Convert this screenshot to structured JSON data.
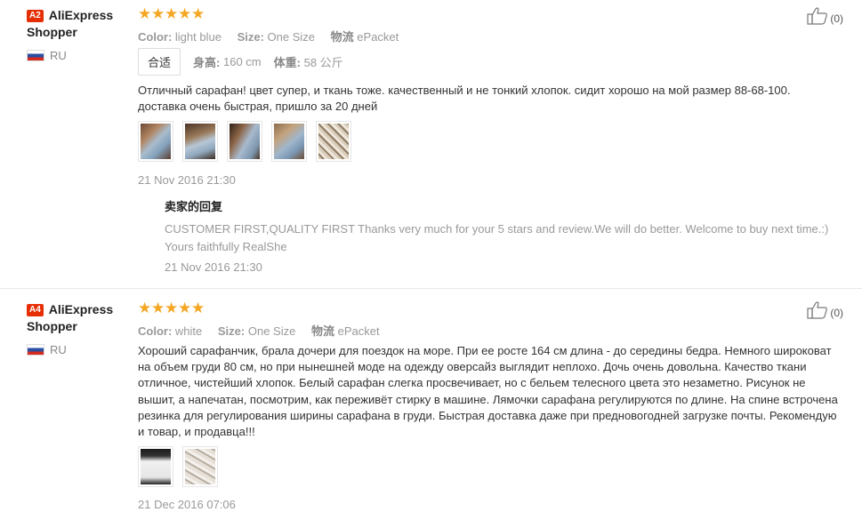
{
  "reviews": [
    {
      "level_badge": "A2",
      "user_name": "AliExpress Shopper",
      "country": "RU",
      "rating": 5,
      "color_label": "Color:",
      "color_value": "light blue",
      "size_label": "Size:",
      "size_value": "One Size",
      "shipping_label": "物流",
      "shipping_value": "ePacket",
      "fit_label": "合适",
      "height_label": "身高:",
      "height_value": "160 cm",
      "weight_label": "体重:",
      "weight_value": "58 公斤",
      "text": "Отличный сарафан! цвет супер, и ткань тоже. качественный и не тонкий хлопок. сидит хорошо на мой размер 88-68-100. доставка очень быстрая, пришло за 20 дней",
      "photos": [
        "photo-1",
        "photo-2",
        "photo-3",
        "photo-4",
        "photo-5"
      ],
      "date": "21 Nov 2016 21:30",
      "helpful_count": "(0)",
      "reply": {
        "title": "卖家的回复",
        "text": "CUSTOMER FIRST,QUALITY FIRST Thanks very much for your 5 stars and review.We will do better. Welcome to buy next time.:) Yours faithfully RealShe",
        "date": "21 Nov 2016 21:30"
      }
    },
    {
      "level_badge": "A4",
      "user_name": "AliExpress Shopper",
      "country": "RU",
      "rating": 5,
      "color_label": "Color:",
      "color_value": "white",
      "size_label": "Size:",
      "size_value": "One Size",
      "shipping_label": "物流",
      "shipping_value": "ePacket",
      "text": "Хороший сарафанчик, брала дочери для поездок на море. При ее росте 164 см длина - до середины бедра. Немного широковат на объем груди 80 см, но при нынешней моде на одежду оверсайз выглядит неплохо. Дочь очень довольна. Качество ткани отличное, чистейший хлопок. Белый сарафан слегка просвечивает, но с бельем телесного цвета это незаметно. Рисунок не вышит, а напечатан, посмотрим, как переживёт стирку в машине. Лямочки сарафана регулируются по длине. На спине встрочена резинка для регулирования ширины сарафана в груди. Быстрая доставка даже при предновогодней загрузке почты. Рекомендую и товар, и продавца!!!",
      "photos": [
        "photo-1",
        "photo-2"
      ],
      "date": "21 Dec 2016 07:06",
      "helpful_count": "(0)"
    }
  ],
  "icons": {
    "star": "star-icon",
    "helpful": "thumbs-up-icon",
    "flag": "ru-flag-icon"
  },
  "colors": {
    "star": "#f5a623",
    "badge": "#e62e04"
  }
}
